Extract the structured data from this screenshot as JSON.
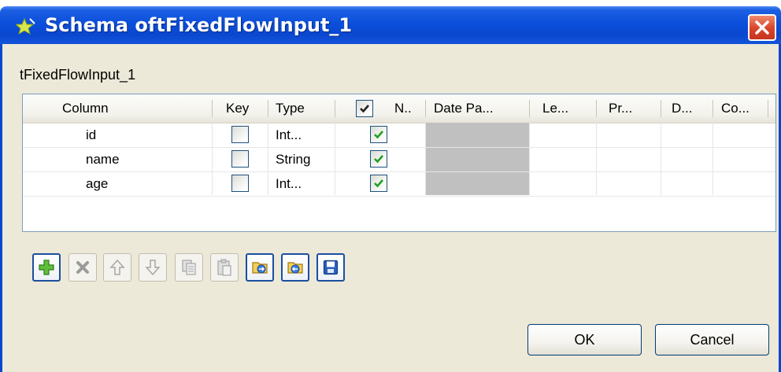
{
  "window": {
    "title": "Schema oftFixedFlowInput_1"
  },
  "schema_name": "tFixedFlowInput_1",
  "table": {
    "headers": {
      "column": "Column",
      "key": "Key",
      "type": "Type",
      "nullable": "N..",
      "date_pattern": "Date Pa...",
      "length": "Le...",
      "precision": "Pr...",
      "default": "D...",
      "comment": "Co..."
    },
    "rows": [
      {
        "column": "id",
        "key": false,
        "type": "Int...",
        "nullable": true
      },
      {
        "column": "name",
        "key": false,
        "type": "String",
        "nullable": true
      },
      {
        "column": "age",
        "key": false,
        "type": "Int...",
        "nullable": true
      }
    ]
  },
  "toolbar": [
    {
      "name": "add-button",
      "icon": "plus-icon",
      "enabled": true
    },
    {
      "name": "remove-button",
      "icon": "x-icon",
      "enabled": false
    },
    {
      "name": "move-up-button",
      "icon": "arrow-up-icon",
      "enabled": false
    },
    {
      "name": "move-down-button",
      "icon": "arrow-down-icon",
      "enabled": false
    },
    {
      "name": "copy-button",
      "icon": "copy-icon",
      "enabled": false
    },
    {
      "name": "paste-button",
      "icon": "paste-icon",
      "enabled": false
    },
    {
      "name": "import-button",
      "icon": "import-icon",
      "enabled": true
    },
    {
      "name": "export-button",
      "icon": "export-icon",
      "enabled": true
    },
    {
      "name": "save-button",
      "icon": "save-icon",
      "enabled": true
    }
  ],
  "buttons": {
    "ok": "OK",
    "cancel": "Cancel"
  },
  "colors": {
    "titlebar": "#0a47cf",
    "dialog_bg": "#ece9d8",
    "close": "#d9432a",
    "check": "#21a121",
    "disabled_cell": "#c0c0c0"
  }
}
